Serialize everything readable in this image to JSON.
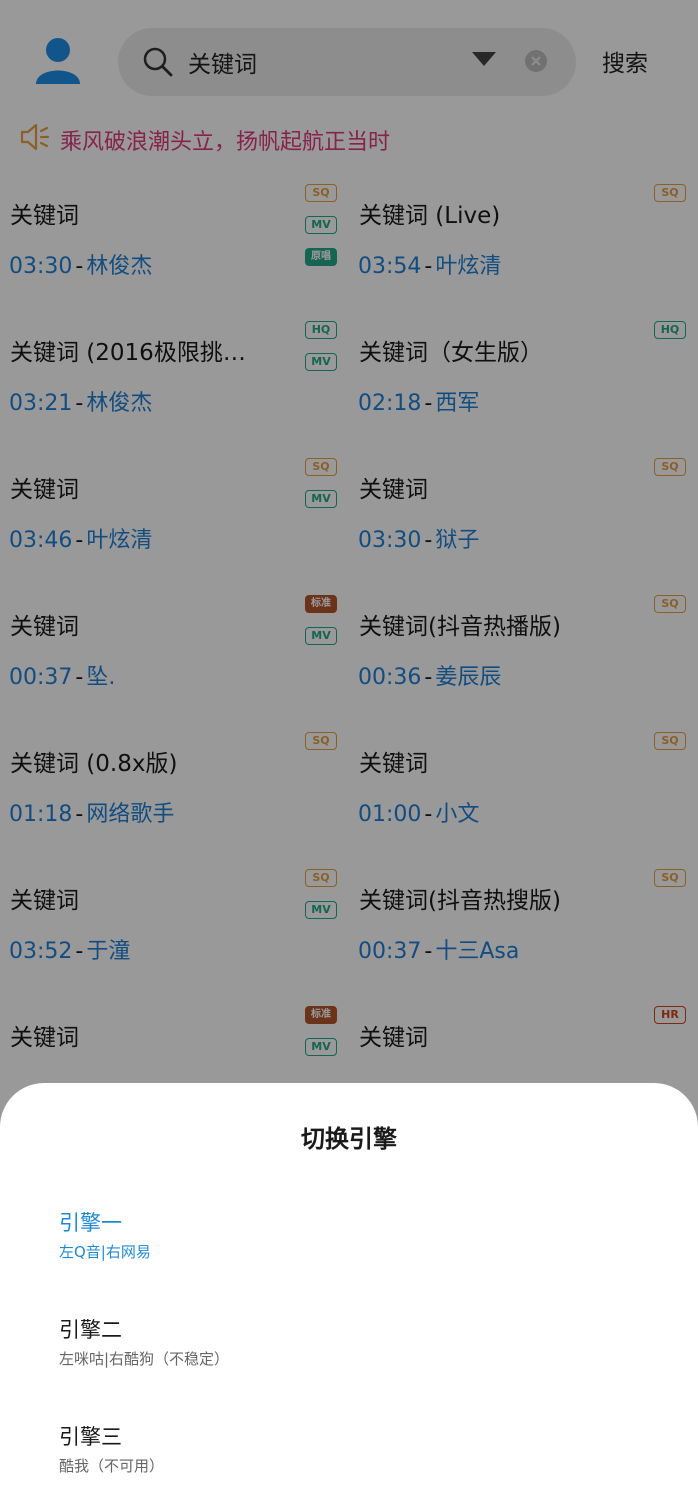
{
  "header": {
    "search_value": "关键词",
    "search_button": "搜索"
  },
  "notice": {
    "text": "乘风破浪潮头立，扬帆起航正当时"
  },
  "songs": [
    {
      "title": "关键词",
      "time": "03:30",
      "artist": "林俊杰",
      "badges": [
        "SQ",
        "MV",
        "原唱"
      ]
    },
    {
      "title": "关键词 (Live)",
      "time": "03:54",
      "artist": "叶炫清",
      "badges": [
        "SQ"
      ]
    },
    {
      "title": "关键词 (2016极限挑…",
      "time": "03:21",
      "artist": "林俊杰",
      "badges": [
        "HQ",
        "MV"
      ]
    },
    {
      "title": "关键词（女生版）",
      "time": "02:18",
      "artist": "西军",
      "badges": [
        "HQ"
      ]
    },
    {
      "title": "关键词",
      "time": "03:46",
      "artist": "叶炫清",
      "badges": [
        "SQ",
        "MV"
      ]
    },
    {
      "title": "关键词",
      "time": "03:30",
      "artist": "狱子",
      "badges": [
        "SQ"
      ]
    },
    {
      "title": "关键词",
      "time": "00:37",
      "artist": "坠.",
      "badges": [
        "标准",
        "MV"
      ]
    },
    {
      "title": "关键词(抖音热播版)",
      "time": "00:36",
      "artist": "姜辰辰",
      "badges": [
        "SQ"
      ]
    },
    {
      "title": "关键词 (0.8x版)",
      "time": "01:18",
      "artist": "网络歌手",
      "badges": [
        "SQ"
      ]
    },
    {
      "title": "关键词",
      "time": "01:00",
      "artist": "小文",
      "badges": [
        "SQ"
      ]
    },
    {
      "title": "关键词",
      "time": "03:52",
      "artist": "于潼",
      "badges": [
        "SQ",
        "MV"
      ]
    },
    {
      "title": "关键词(抖音热搜版)",
      "time": "00:37",
      "artist": "十三Asa",
      "badges": [
        "SQ"
      ]
    },
    {
      "title": "关键词",
      "time": "",
      "artist": "",
      "badges": [
        "标准",
        "MV"
      ]
    },
    {
      "title": "关键词",
      "time": "",
      "artist": "",
      "badges": [
        "HR"
      ]
    }
  ],
  "sheet": {
    "title": "切换引擎",
    "engines": [
      {
        "name": "引擎一",
        "desc": "左Q音|右网易",
        "active": true
      },
      {
        "name": "引擎二",
        "desc": "左咪咕|右酷狗（不稳定）",
        "active": false
      },
      {
        "name": "引擎三",
        "desc": "酷我（不可用）",
        "active": false
      }
    ]
  },
  "colors": {
    "accent_blue": "#1e7fd6",
    "notice_pink": "#e23a7c",
    "sq_orange": "#e7a043",
    "hq_green": "#23a989",
    "hr_red": "#d9421f"
  }
}
